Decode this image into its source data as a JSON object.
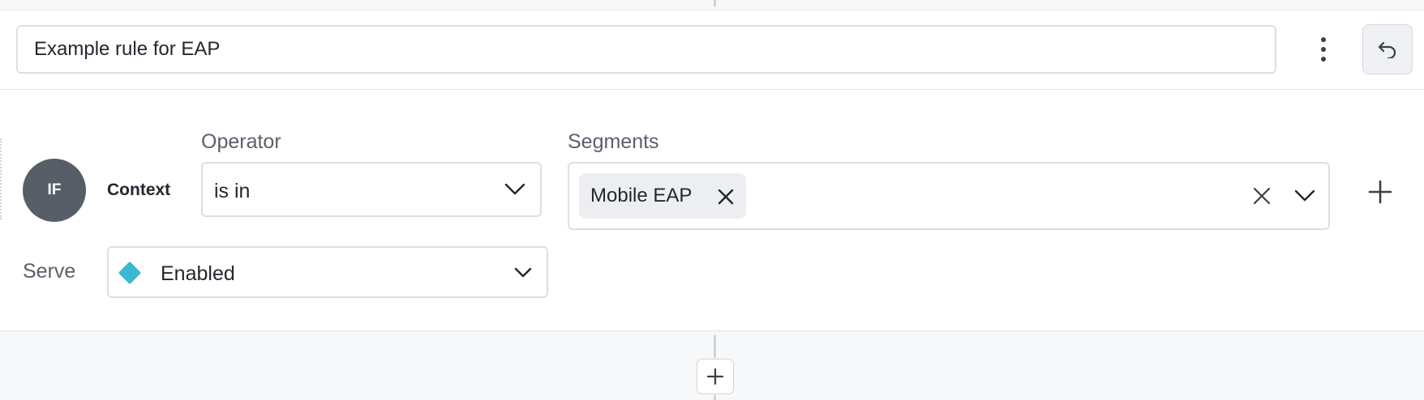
{
  "rule": {
    "name": "Example rule for EAP",
    "badge": "IF",
    "attribute_label": "Context"
  },
  "operator": {
    "label": "Operator",
    "value": "is in"
  },
  "segments": {
    "label": "Segments",
    "selected": [
      "Mobile EAP"
    ]
  },
  "serve": {
    "label": "Serve",
    "value": "Enabled",
    "color": "#3bb8d3"
  },
  "icons": {
    "more": "more-vertical-icon",
    "undo": "undo-icon",
    "chevron": "chevron-down-icon",
    "remove": "close-icon",
    "add": "plus-icon"
  },
  "colors": {
    "badge_bg": "#585e68",
    "chip_bg": "#eceef1",
    "border": "#dcdfe4"
  }
}
